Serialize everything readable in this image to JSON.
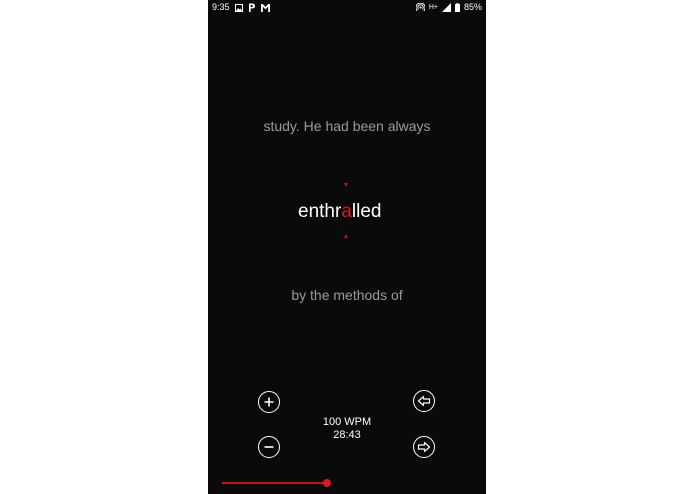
{
  "status_bar": {
    "time": "9:35",
    "network_type": "H+",
    "battery": "85%",
    "notification_icons": [
      "image-icon",
      "p-app-icon",
      "gmail-icon"
    ],
    "system_icons": [
      "hotspot-icon",
      "signal-icon",
      "battery-icon"
    ]
  },
  "reader": {
    "previous_text": "study. He had been always",
    "focus_word": {
      "before": "enthr",
      "pivot": "a",
      "after": "lled"
    },
    "next_text": "by the methods of",
    "accent_color": "#e3141b"
  },
  "controls": {
    "wpm_label": "100 WPM",
    "time_remaining": "28:43",
    "increase_speed_icon": "plus-circle-icon",
    "decrease_speed_icon": "minus-circle-icon",
    "rewind_icon": "arrow-left-circle-icon",
    "forward_icon": "arrow-right-circle-icon"
  },
  "progress": {
    "fraction": 0.42
  }
}
